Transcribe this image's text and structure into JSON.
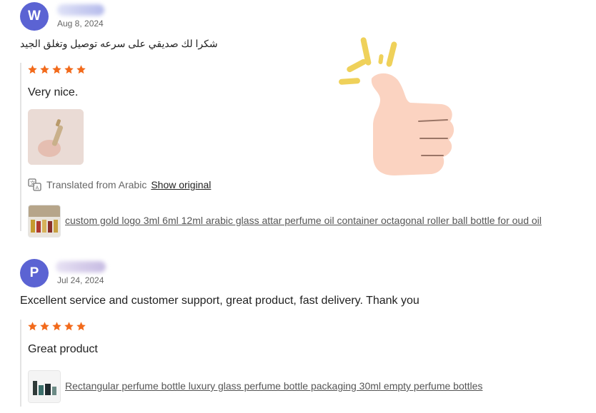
{
  "reviews": [
    {
      "avatar_letter": "W",
      "date": "Aug 8, 2024",
      "comment": "شكرا لك صديقي على سرعه توصيل وتغلق الجيد",
      "rating": 5,
      "text": "Very nice.",
      "translation_note": "Translated from Arabic",
      "show_original_label": "Show original",
      "product_title": "custom gold logo 3ml 6ml 12ml arabic glass attar perfume oil container octagonal roller ball bottle for oud oil"
    },
    {
      "avatar_letter": "P",
      "date": "Jul 24, 2024",
      "comment": "Excellent service and customer support, great product, fast delivery. Thank you",
      "rating": 5,
      "text": "Great product",
      "product_title": "Rectangular perfume bottle luxury glass perfume bottle packaging 30ml empty perfume bottles"
    }
  ],
  "colors": {
    "avatar": "#5b63d3",
    "star": "#f26a1b",
    "thumb_skin": "#fbd3c1",
    "spark": "#efd15a"
  },
  "icons": {
    "rating_star": "star-icon",
    "translate": "translate-icon",
    "sticker": "thumbs-up-icon"
  }
}
